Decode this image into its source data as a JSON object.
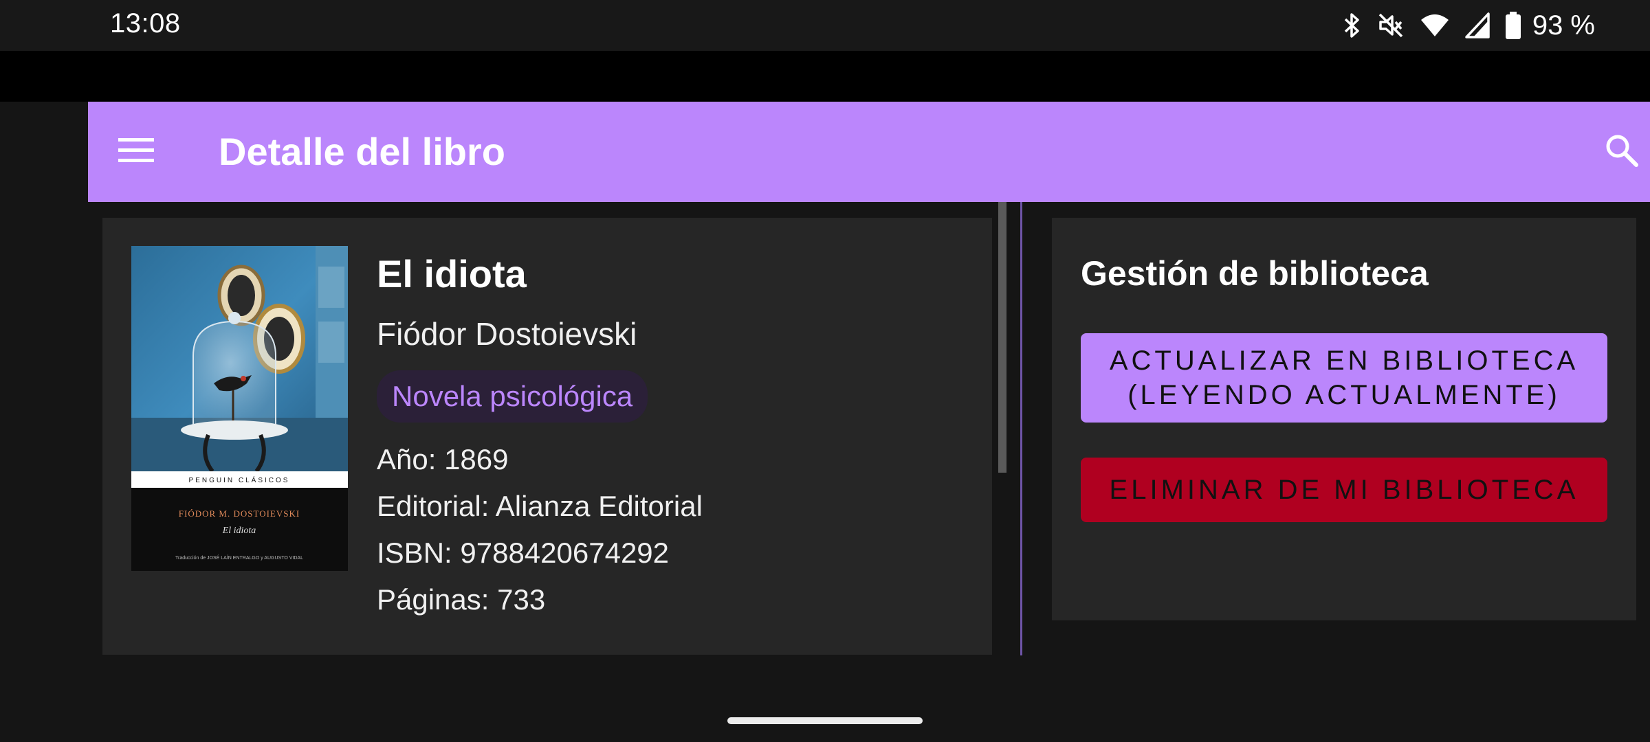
{
  "status_bar": {
    "time": "13:08",
    "battery_percent": "93 %",
    "icons": [
      "bluetooth-icon",
      "mute-icon",
      "wifi-icon",
      "signal-icon",
      "battery-icon"
    ]
  },
  "app_bar": {
    "title": "Detalle del libro",
    "menu_icon": "menu-icon",
    "search_icon": "search-icon",
    "color": "#bb86fc"
  },
  "book": {
    "title": "El idiota",
    "author": "Fiódor Dostoievski",
    "genre": "Novela psicológica",
    "year": "Año: 1869",
    "publisher": "Editorial: Alianza Editorial",
    "isbn": "ISBN: 9788420674292",
    "pages": "Páginas: 733",
    "cover": {
      "series": "PENGUIN  CLÁSICOS",
      "author": "FIÓDOR M. DOSTOIEVSKI",
      "title": "El idiota",
      "credits": "Traducción de JOSÉ LAÍN ENTRALGO y AUGUSTO VIDAL"
    }
  },
  "library": {
    "title": "Gestión de biblioteca",
    "update_button": "ACTUALIZAR EN BIBLIOTECA\n(LEYENDO ACTUALMENTE)",
    "delete_button": "ELIMINAR DE MI BIBLIOTECA",
    "update_color": "#bb86fc",
    "delete_color": "#b00020"
  }
}
